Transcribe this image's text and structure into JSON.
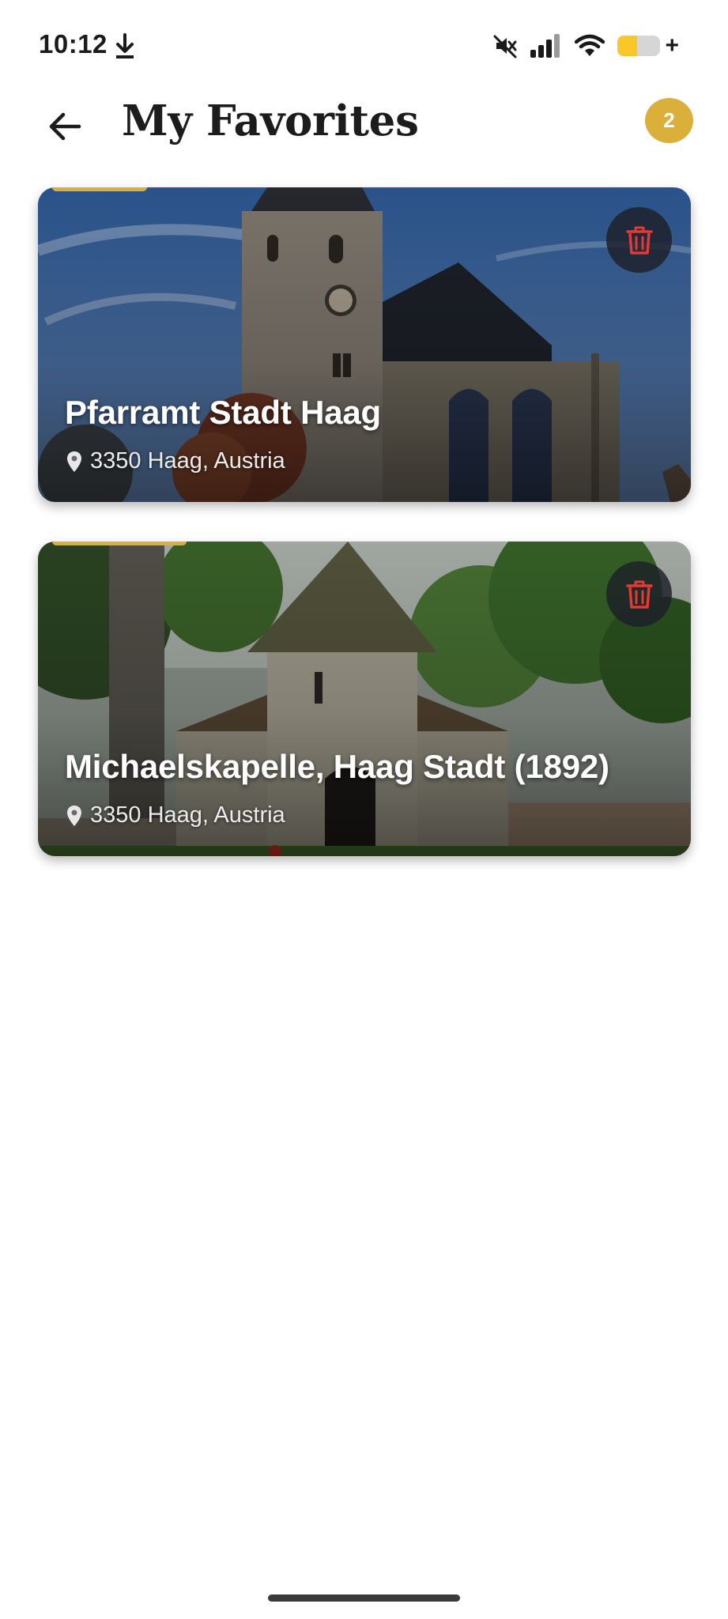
{
  "status_bar": {
    "time": "10:12",
    "icons": [
      "download-icon",
      "mute-icon",
      "signal-icon",
      "wifi-icon",
      "battery-icon"
    ],
    "battery_level": 0.45,
    "battery_color": "#f7c827"
  },
  "header": {
    "title": "My Favorites",
    "favorites_count": "2",
    "badge_color": "#dbb03a",
    "back_icon": "arrow-left-icon"
  },
  "favorites": [
    {
      "title": "Pfarramt Stadt Haag",
      "location": "3350 Haag, Austria",
      "delete_icon": "trash-icon"
    },
    {
      "title": "Michaelskapelle, Haag Stadt (1892)",
      "location": "3350 Haag, Austria",
      "delete_icon": "trash-icon"
    }
  ],
  "colors": {
    "accent": "#dbb03a",
    "delete_icon": "#e53935"
  }
}
